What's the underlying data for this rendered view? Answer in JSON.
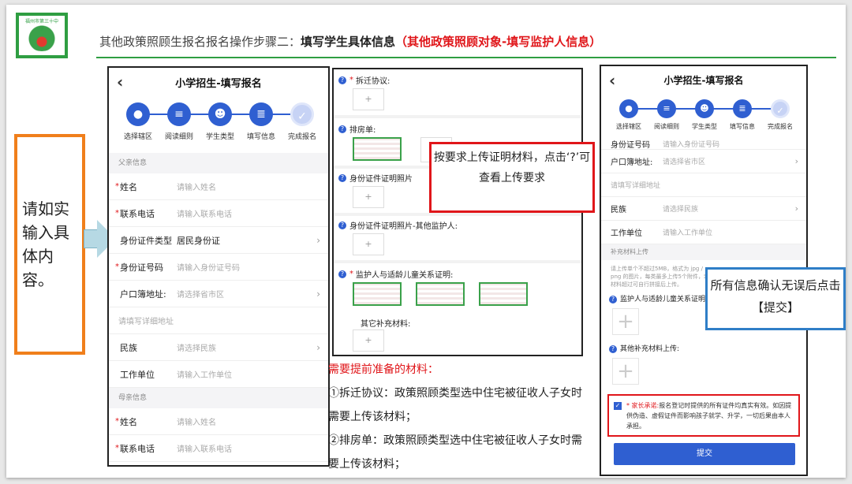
{
  "logo": {
    "text": "福州市第三十中学",
    "icon": "school-logo"
  },
  "slide_title": {
    "prefix": "其他政策照顾生报名报名操作步骤二：",
    "bold": "填写学生具体信息",
    "red": "（其他政策照顾对象-填写监护人信息）"
  },
  "left_box": {
    "text": "请如实输入具体内容。"
  },
  "phone1": {
    "title": "小学招生-填写报名",
    "back": "‹",
    "steps": [
      "选择辖区",
      "阅读细则",
      "学生类型",
      "填写信息",
      "完成报名"
    ],
    "father_section": "父亲信息",
    "mother_section": "母亲信息",
    "rows": {
      "name_label": "姓名",
      "name_ph": "请输入姓名",
      "phone_label": "联系电话",
      "phone_ph": "请输入联系电话",
      "idtype_label": "身份证件类型",
      "idtype_val": "居民身份证",
      "idno_label": "身份证号码",
      "idno_ph": "请输入身份证号码",
      "hukou_label": "户口簿地址:",
      "hukou_ph": "请选择省市区",
      "addr_ph": "请填写详细地址",
      "nation_label": "民族",
      "nation_ph": "请选择民族",
      "work_label": "工作单位",
      "work_ph": "请输入工作单位",
      "mname_label": "姓名",
      "mname_ph": "请输入姓名",
      "mphone_label": "联系电话",
      "mphone_ph": "请输入联系电话"
    }
  },
  "panel2": {
    "items": [
      "拆迁协议:",
      "排房单:",
      "身份证件证明照片",
      "身份证件证明照片-其他监护人:",
      "监护人与适龄儿童关系证明:",
      "其它补充材料:"
    ],
    "add": "+",
    "callout": "按要求上传证明材料，点击‘?’可查看上传要求"
  },
  "notes": {
    "heading": "需要提前准备的材料：",
    "line1": "①拆迁协议：政策照顾类型选中住宅被征收人子女时需要上传该材料；",
    "line2": "②排房单：政策照顾类型选中住宅被征收人子女时需要上传该材料；"
  },
  "phone3": {
    "title": "小学招生-填写报名",
    "back": "‹",
    "steps": [
      "选择辖区",
      "阅读细则",
      "学生类型",
      "填写信息",
      "完成报名"
    ],
    "idno_label": "身份证号码",
    "idno_ph": "请输入身份证号码",
    "hukou_label": "户口簿地址:",
    "hukou_ph": "请选择省市区",
    "addr_ph": "请填写详细地址",
    "nation_label": "民族",
    "nation_ph": "请选择民族",
    "work_label": "工作单位",
    "work_ph": "请输入工作单位",
    "supp_section": "补充材料上传",
    "supp_note": "请上传单个不超过5MB，格式为 jpg / png 的图片，每类最多上传5个附件，若材料超过可自行拼接后上传。",
    "relation_label": "监护人与适龄儿童关系证明",
    "other_label": "其他补充材料上传:",
    "pledge_req": "* 家长承诺:",
    "pledge_text": "报名登记时提供的所有证件均真实有效。如因提供伪造、虚假证件而影响孩子就学、升学，一切后果由本人承担。",
    "submit": "提交"
  },
  "bottom_callout": "所有信息确认无误后点击【提交】",
  "colors": {
    "accent_blue": "#2f5fd1",
    "red": "#e0161a",
    "green": "#2f9e42",
    "orange": "#f07f1b"
  }
}
